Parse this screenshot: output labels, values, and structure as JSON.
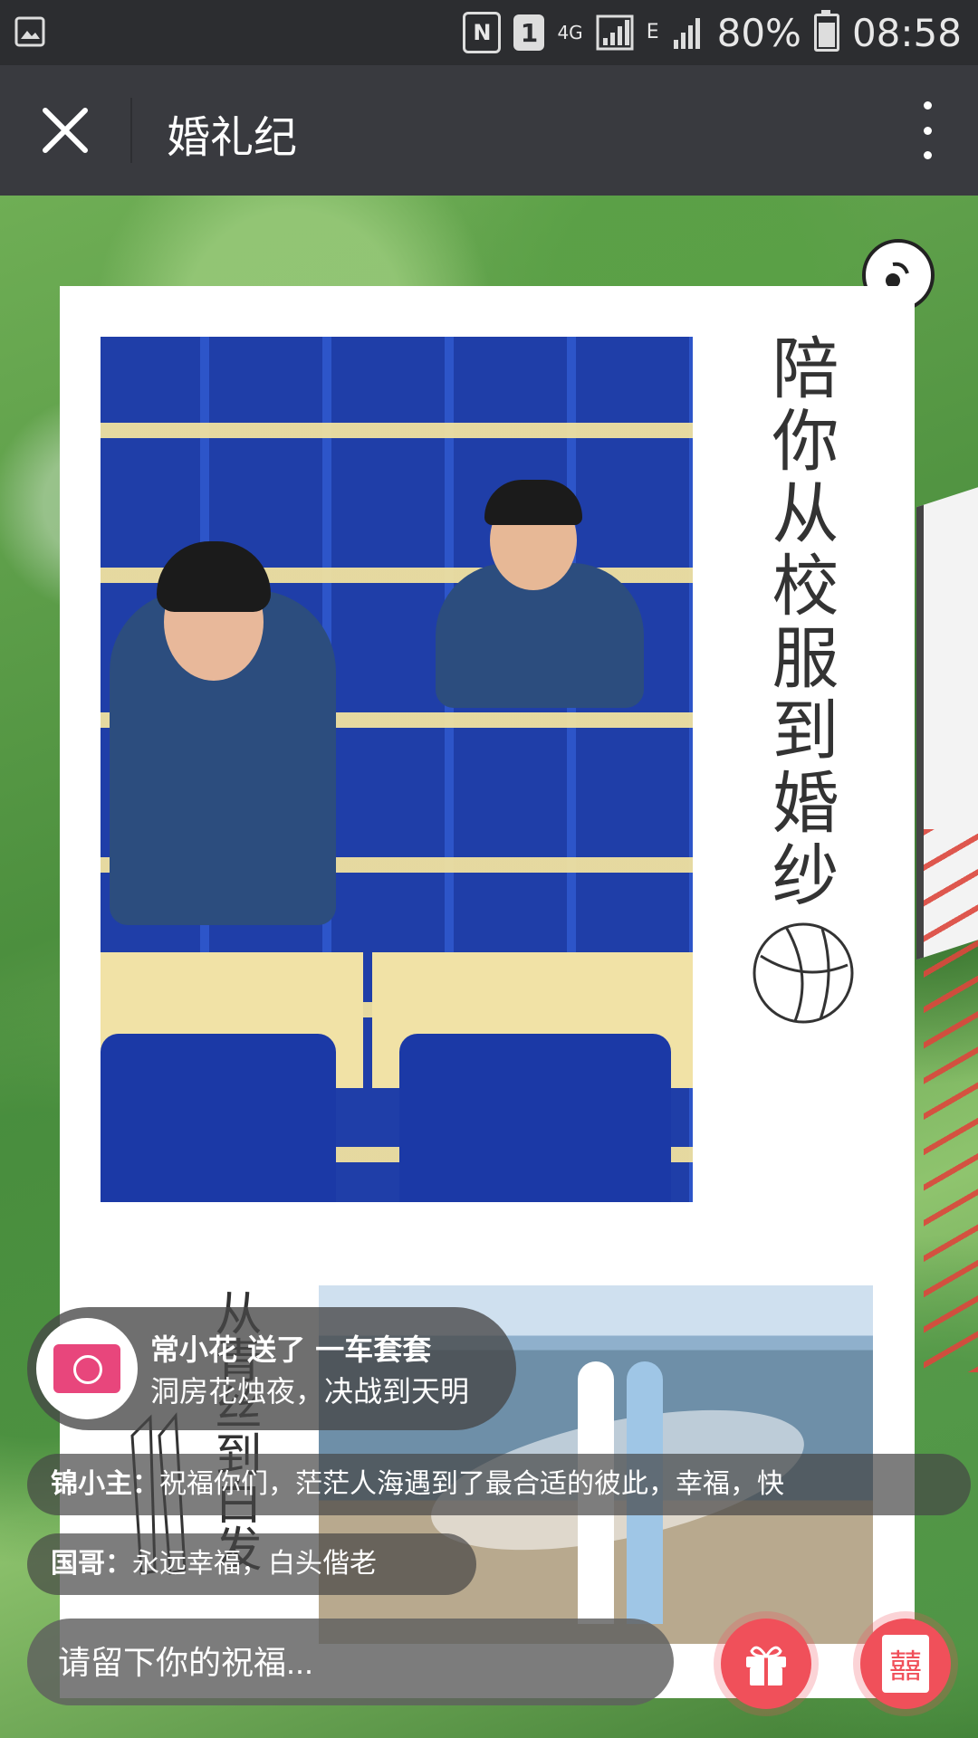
{
  "status_bar": {
    "gallery_icon": "image-icon",
    "nfc": "N",
    "sim": "1",
    "network_top": "4G",
    "network_e": "E",
    "battery": "80%",
    "time": "08:58"
  },
  "title_bar": {
    "title": "婚礼纪",
    "close_icon": "close-icon",
    "more_icon": "more-vertical-icon"
  },
  "card": {
    "vertical_text_1": "陪你从校服到婚纱",
    "vertical_text_2": "从青丝到白发",
    "music_icon": "music-note-icon",
    "ball_icon": "basketball-icon",
    "pencil_icon": "pencil-icon"
  },
  "gift_toast": {
    "line1": "常小花 送了 一车套套",
    "line2": "洞房花烛夜，决战到天明",
    "avatar_icon": "gift-package-icon"
  },
  "messages": [
    {
      "author": "锦小主：",
      "text": "祝福你们，茫茫人海遇到了最合适的彼此，幸福，快"
    },
    {
      "author": "国哥：",
      "text": "永远幸福，白头偕老"
    }
  ],
  "input": {
    "placeholder": "请留下你的祝福..."
  },
  "buttons": {
    "gift_icon": "gift-icon",
    "xi_glyph": "囍"
  },
  "colors": {
    "accent": "#f0505a",
    "title_bar": "#393a3f",
    "status_bar": "#2c2d30"
  }
}
